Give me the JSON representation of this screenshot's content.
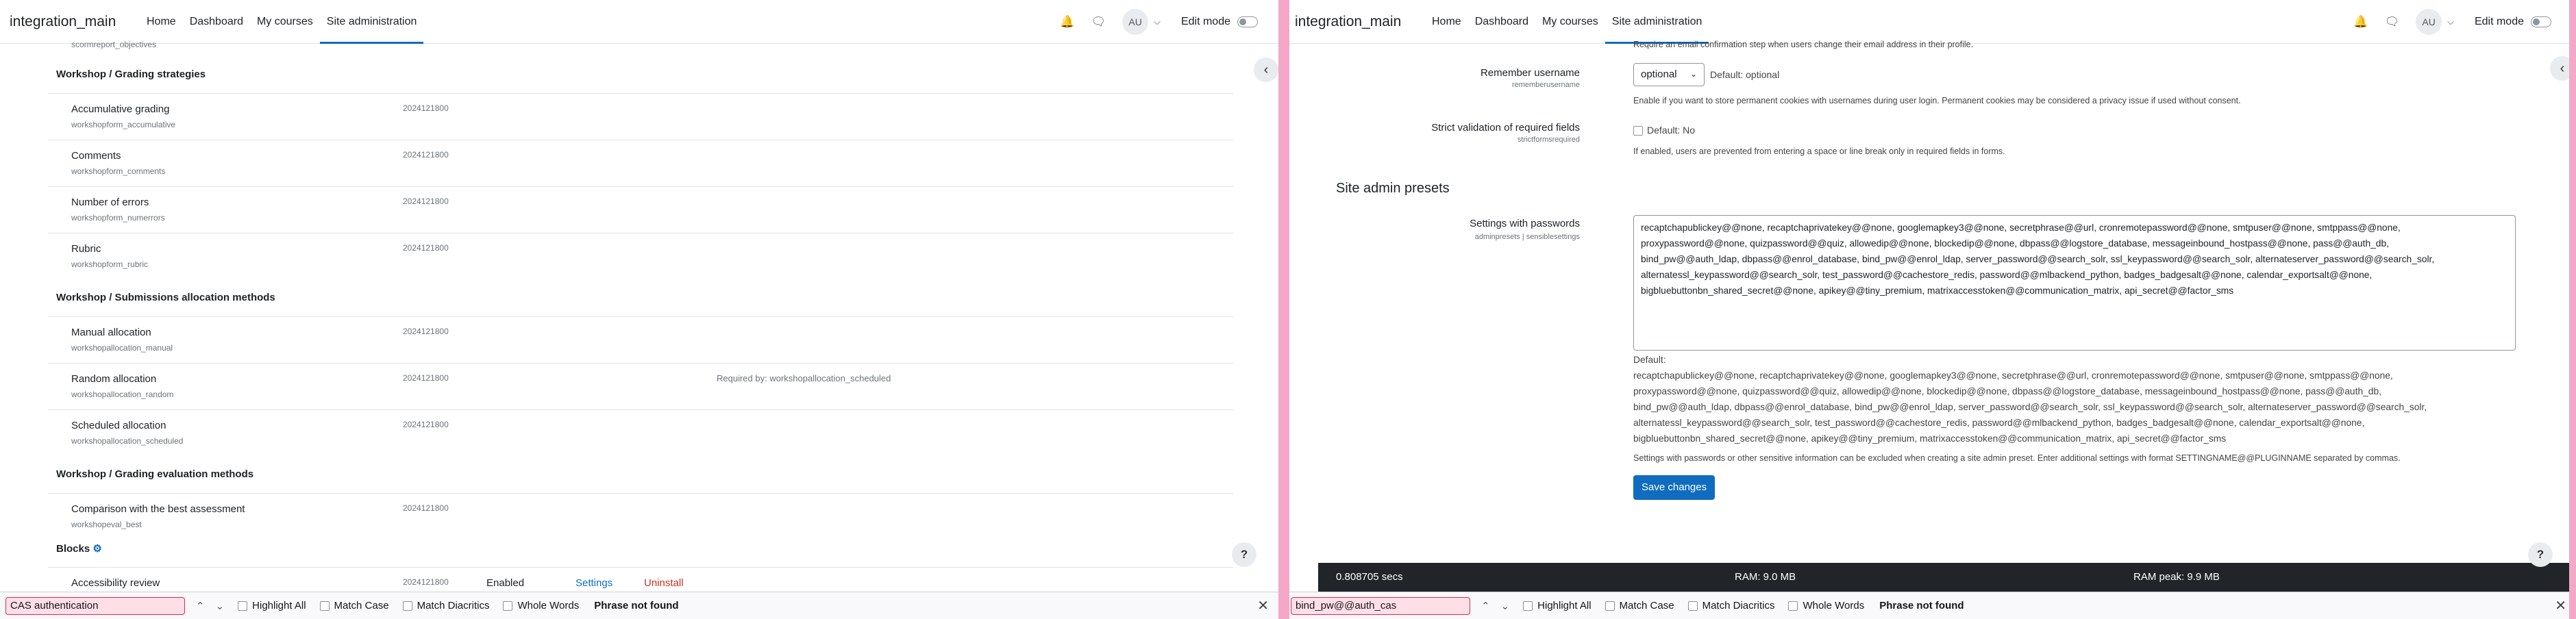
{
  "left": {
    "brand": "integration_main",
    "nav": [
      "Home",
      "Dashboard",
      "My courses",
      "Site administration"
    ],
    "user_initials": "AU",
    "edit_mode": "Edit mode",
    "cut_text": "scormreport_objectives",
    "sections": [
      {
        "title": "Workshop / Grading strategies",
        "rows": [
          {
            "name": "Accumulative grading",
            "sub": "workshopform_accumulative",
            "ver": "2024121800"
          },
          {
            "name": "Comments",
            "sub": "workshopform_comments",
            "ver": "2024121800"
          },
          {
            "name": "Number of errors",
            "sub": "workshopform_numerrors",
            "ver": "2024121800"
          },
          {
            "name": "Rubric",
            "sub": "workshopform_rubric",
            "ver": "2024121800"
          }
        ]
      },
      {
        "title": "Workshop / Submissions allocation methods",
        "rows": [
          {
            "name": "Manual allocation",
            "sub": "workshopallocation_manual",
            "ver": "2024121800"
          },
          {
            "name": "Random allocation",
            "sub": "workshopallocation_random",
            "ver": "2024121800",
            "req": "Required by: workshopallocation_scheduled"
          },
          {
            "name": "Scheduled allocation",
            "sub": "workshopallocation_scheduled",
            "ver": "2024121800"
          }
        ]
      },
      {
        "title": "Workshop / Grading evaluation methods",
        "rows": [
          {
            "name": "Comparison with the best assessment",
            "sub": "workshopeval_best",
            "ver": "2024121800"
          }
        ]
      }
    ],
    "blocks_title": "Blocks",
    "blocks_row": {
      "name": "Accessibility review",
      "ver": "2024121800",
      "enabled": "Enabled",
      "settings": "Settings",
      "uninstall": "Uninstall"
    },
    "find": {
      "value": "CAS authentication",
      "highlight": "Highlight All",
      "match_case": "Match Case",
      "diacritics": "Match Diacritics",
      "whole": "Whole Words",
      "status": "Phrase not found"
    }
  },
  "right": {
    "brand": "integration_main",
    "nav": [
      "Home",
      "Dashboard",
      "My courses",
      "Site administration"
    ],
    "user_initials": "AU",
    "edit_mode": "Edit mode",
    "top_note": "Require an email confirmation step when users change their email address in their profile.",
    "remember": {
      "label": "Remember username",
      "sub": "rememberusername",
      "value": "optional",
      "default": "Default: optional",
      "desc": "Enable if you want to store permanent cookies with usernames during user login. Permanent cookies may be considered a privacy issue if used without consent."
    },
    "strict": {
      "label": "Strict validation of required fields",
      "sub": "strictformsrequired",
      "default": "Default: No",
      "desc": "If enabled, users are prevented from entering a space or line break only in required fields in forms."
    },
    "presets_title": "Site admin presets",
    "passwords": {
      "label": "Settings with passwords",
      "sub": "adminpresets | sensiblesettings",
      "lines": [
        "recaptchapublickey@@none, recaptchaprivatekey@@none, googlemapkey3@@none, secretphrase@@url, cronremotepassword@@none, smtpuser@@none, smtppass@@none,",
        "proxypassword@@none, quizpassword@@quiz, allowedip@@none, blockedip@@none, dbpass@@logstore_database, messageinbound_hostpass@@none, pass@@auth_db,",
        "bind_pw@@auth_ldap, dbpass@@enrol_database, bind_pw@@enrol_ldap, server_password@@search_solr, ssl_keypassword@@search_solr, alternateserver_password@@search_solr,",
        "alternatessl_keypassword@@search_solr, test_password@@cachestore_redis, password@@mlbackend_python, badges_badgesalt@@none, calendar_exportsalt@@none,",
        "bigbluebuttonbn_shared_secret@@none, apikey@@tiny_premium, matrixaccesstoken@@communication_matrix, api_secret@@factor_sms"
      ],
      "default_label": "Default:",
      "default_lines": [
        "recaptchapublickey@@none, recaptchaprivatekey@@none, googlemapkey3@@none, secretphrase@@url, cronremotepassword@@none, smtpuser@@none, smtppass@@none,",
        "proxypassword@@none, quizpassword@@quiz, allowedip@@none, blockedip@@none, dbpass@@logstore_database, messageinbound_hostpass@@none, pass@@auth_db,",
        "bind_pw@@auth_ldap, dbpass@@enrol_database, bind_pw@@enrol_ldap, server_password@@search_solr, ssl_keypassword@@search_solr, alternateserver_password@@search_solr,",
        "alternatessl_keypassword@@search_solr, test_password@@cachestore_redis, password@@mlbackend_python, badges_badgesalt@@none, calendar_exportsalt@@none,",
        "bigbluebuttonbn_shared_secret@@none, apikey@@tiny_premium, matrixaccesstoken@@communication_matrix, api_secret@@factor_sms"
      ],
      "desc": "Settings with passwords or other sensitive information can be excluded when creating a site admin preset. Enter additional settings with format SETTINGNAME@@PLUGINNAME separated by commas."
    },
    "save": "Save changes",
    "footer": {
      "time": "0.808705 secs",
      "ram": "RAM: 9.0 MB",
      "peak": "RAM peak: 9.9 MB"
    },
    "find": {
      "value": "bind_pw@@auth_cas",
      "highlight": "Highlight All",
      "match_case": "Match Case",
      "diacritics": "Match Diacritics",
      "whole": "Whole Words",
      "status": "Phrase not found"
    }
  }
}
